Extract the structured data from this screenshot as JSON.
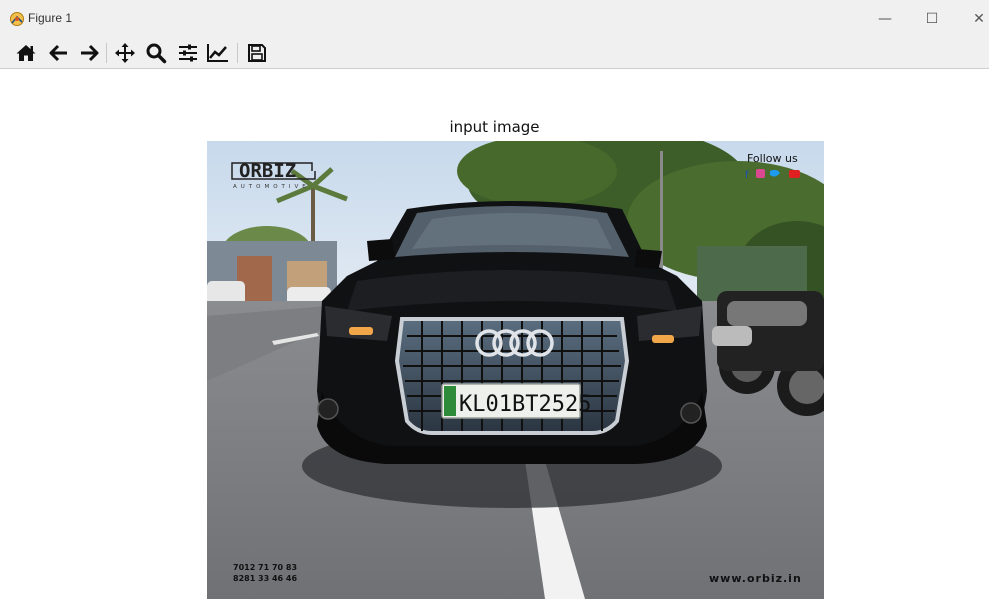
{
  "window": {
    "title": "Figure 1",
    "controls": [
      "minimize",
      "maximize",
      "close"
    ],
    "minimize_glyph": "—",
    "maximize_glyph": "☐",
    "close_glyph": "✕"
  },
  "toolbar": {
    "buttons": [
      {
        "icon": "home-icon",
        "name": "Home"
      },
      {
        "icon": "back-arrow-icon",
        "name": "Back"
      },
      {
        "icon": "forward-arrow-icon",
        "name": "Forward"
      },
      {
        "icon": "pan-icon",
        "name": "Pan"
      },
      {
        "icon": "zoom-icon",
        "name": "Zoom"
      },
      {
        "icon": "subplots-icon",
        "name": "Subplots"
      },
      {
        "icon": "edit-axis-icon",
        "name": "Customize"
      },
      {
        "icon": "save-icon",
        "name": "Save"
      }
    ]
  },
  "figure": {
    "title": "input image",
    "image": {
      "logo_text": "ORBIZ",
      "logo_subtext": "AUTOMOTIVE",
      "follow_label": "Follow us",
      "plate_text": "KL01BT2525",
      "phone_1": "7012 71 70 83",
      "phone_2": "8281 33 46 46",
      "website": "www.orbiz.in"
    }
  },
  "colors": {
    "toolbar_bg": "#f0f0f0",
    "car_body": "#0f1012",
    "plate_bg": "#eef0ec",
    "plate_strip": "#2e8b3a"
  }
}
